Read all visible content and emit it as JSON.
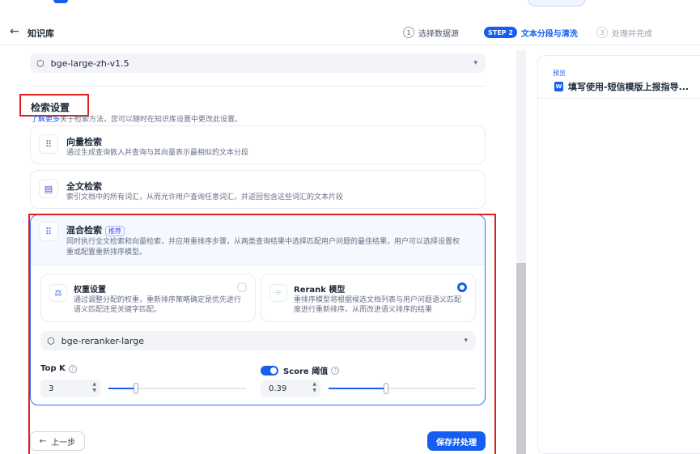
{
  "header": {
    "back_label": "知识库",
    "steps": [
      {
        "num": "1",
        "label": "选择数据源"
      },
      {
        "badge": "STEP 2",
        "label": "文本分段与清洗"
      },
      {
        "num": "3",
        "label": "处理并完成"
      }
    ]
  },
  "embedding": {
    "model": "bge-large-zh-v1.5"
  },
  "retrieval": {
    "title": "检索设置",
    "desc_link": "了解更多",
    "desc": "关于检索方法，您可以随时在知识库设置中更改此设置。",
    "vector": {
      "title": "向量检索",
      "desc": "通过生成查询嵌入并查询与其向量表示最相似的文本分段"
    },
    "fulltext": {
      "title": "全文检索",
      "desc": "索引文档中的所有词汇，从而允许用户查询任意词汇，并返回包含这些词汇的文本片段"
    },
    "hybrid": {
      "title": "混合检索",
      "badge": "推荐",
      "desc_line1": "同时执行全文检索和向量检索，并应用重排序步骤，从两类查询结果中选择匹配用户问题的最佳结果，用户可以选择设置权",
      "desc_line2": "重或配置重新排序模型。",
      "weight": {
        "title": "权重设置",
        "desc": "通过调整分配的权重，重新排序策略确定是优先进行语义匹配还是关键字匹配。"
      },
      "rerank": {
        "title": "Rerank 模型",
        "desc": "重排序模型将根据候选文档列表与用户问题语义匹配度进行重新排序，从而改进语义排序的结果"
      },
      "rerank_model": "bge-reranker-large",
      "topk": {
        "label": "Top K",
        "value": "3",
        "fraction": 0.2
      },
      "score": {
        "label": "Score 阈值",
        "value": "0.39",
        "fraction": 0.39
      }
    }
  },
  "buttons": {
    "prev": "上一步",
    "save": "保存并处理"
  },
  "preview": {
    "label": "预览",
    "doc_title": "填写使用-短信模版上报指导..."
  }
}
